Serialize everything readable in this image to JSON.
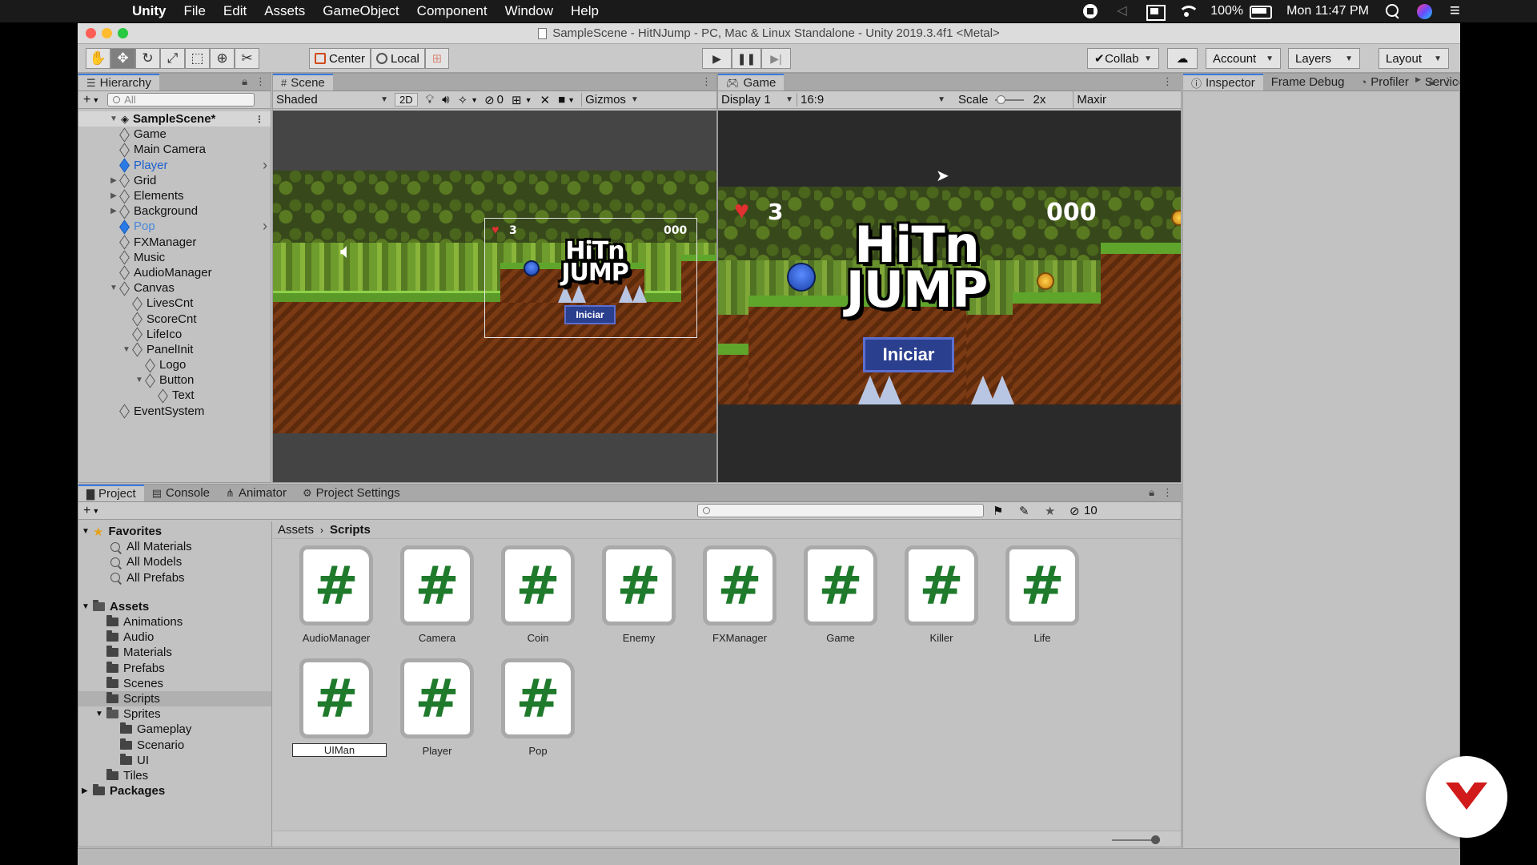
{
  "menubar": {
    "app": "Unity",
    "items": [
      "File",
      "Edit",
      "Assets",
      "GameObject",
      "Component",
      "Window",
      "Help"
    ],
    "battery": "100%",
    "clock": "Mon 11:47 PM"
  },
  "window": {
    "title": "SampleScene - HitNJump - PC, Mac & Linux Standalone - Unity 2019.3.4f1 <Metal>"
  },
  "toolbar": {
    "pivot": "Center",
    "space": "Local",
    "collab": "Collab",
    "account": "Account",
    "layers": "Layers",
    "layout": "Layout"
  },
  "hierarchy": {
    "tab": "Hierarchy",
    "search_placeholder": "All",
    "scene": "SampleScene*",
    "items": [
      {
        "label": "Game",
        "depth": 1,
        "style": "normal",
        "expand": "none"
      },
      {
        "label": "Main Camera",
        "depth": 1,
        "style": "normal",
        "expand": "none"
      },
      {
        "label": "Player",
        "depth": 1,
        "style": "blue",
        "expand": "none",
        "chevron": true
      },
      {
        "label": "Grid",
        "depth": 1,
        "style": "normal",
        "expand": "collapsed"
      },
      {
        "label": "Elements",
        "depth": 1,
        "style": "normal",
        "expand": "collapsed"
      },
      {
        "label": "Background",
        "depth": 1,
        "style": "normal",
        "expand": "collapsed"
      },
      {
        "label": "Pop",
        "depth": 1,
        "style": "lightblue",
        "expand": "none",
        "chevron": true
      },
      {
        "label": "FXManager",
        "depth": 1,
        "style": "normal",
        "expand": "none"
      },
      {
        "label": "Music",
        "depth": 1,
        "style": "normal",
        "expand": "none"
      },
      {
        "label": "AudioManager",
        "depth": 1,
        "style": "normal",
        "expand": "none"
      },
      {
        "label": "Canvas",
        "depth": 1,
        "style": "normal",
        "expand": "expanded"
      },
      {
        "label": "LivesCnt",
        "depth": 2,
        "style": "normal",
        "expand": "none"
      },
      {
        "label": "ScoreCnt",
        "depth": 2,
        "style": "normal",
        "expand": "none"
      },
      {
        "label": "LifeIco",
        "depth": 2,
        "style": "normal",
        "expand": "none"
      },
      {
        "label": "PanelInit",
        "depth": 2,
        "style": "normal",
        "expand": "expanded"
      },
      {
        "label": "Logo",
        "depth": 3,
        "style": "normal",
        "expand": "none"
      },
      {
        "label": "Button",
        "depth": 3,
        "style": "normal",
        "expand": "expanded"
      },
      {
        "label": "Text",
        "depth": 4,
        "style": "normal",
        "expand": "none"
      },
      {
        "label": "EventSystem",
        "depth": 1,
        "style": "normal",
        "expand": "none"
      }
    ]
  },
  "scene": {
    "tab": "Scene",
    "shading": "Shaded",
    "mode_2d": "2D",
    "hidden_count": "0",
    "gizmos": "Gizmos"
  },
  "game": {
    "tab": "Game",
    "display": "Display 1",
    "aspect": "16:9",
    "scale_label": "Scale",
    "scale_value": "2x",
    "maximize": "Maximize",
    "hud_lives": "3",
    "hud_score": "000",
    "logo_line1": "HiTn",
    "logo_line2": "JUMP",
    "start_button": "Iniciar"
  },
  "inspector": {
    "tabs": [
      "Inspector",
      "Frame Debug",
      "Profiler",
      "Service"
    ]
  },
  "project": {
    "tabs": [
      "Project",
      "Console",
      "Animator",
      "Project Settings"
    ],
    "hidden_count": "10",
    "breadcrumb": [
      "Assets",
      "Scripts"
    ],
    "favorites": {
      "label": "Favorites",
      "items": [
        "All Materials",
        "All Models",
        "All Prefabs"
      ]
    },
    "assets_root": "Assets",
    "folders": [
      {
        "label": "Animations",
        "depth": 1,
        "expand": "none"
      },
      {
        "label": "Audio",
        "depth": 1,
        "expand": "none"
      },
      {
        "label": "Materials",
        "depth": 1,
        "expand": "none"
      },
      {
        "label": "Prefabs",
        "depth": 1,
        "expand": "none"
      },
      {
        "label": "Scenes",
        "depth": 1,
        "expand": "none"
      },
      {
        "label": "Scripts",
        "depth": 1,
        "expand": "none",
        "selected": true
      },
      {
        "label": "Sprites",
        "depth": 1,
        "expand": "expanded"
      },
      {
        "label": "Gameplay",
        "depth": 2,
        "expand": "none"
      },
      {
        "label": "Scenario",
        "depth": 2,
        "expand": "none"
      },
      {
        "label": "UI",
        "depth": 2,
        "expand": "none"
      },
      {
        "label": "Tiles",
        "depth": 1,
        "expand": "none"
      }
    ],
    "packages": "Packages",
    "scripts": [
      "AudioManager",
      "Camera",
      "Coin",
      "Enemy",
      "FXManager",
      "Game",
      "Killer",
      "Life",
      "UIMan",
      "Player",
      "Pop"
    ],
    "script_glyph": "#"
  },
  "colors": {
    "accent": "#3a7ae0",
    "script_green": "#1f7a2c",
    "badge_red": "#d11a1a"
  }
}
